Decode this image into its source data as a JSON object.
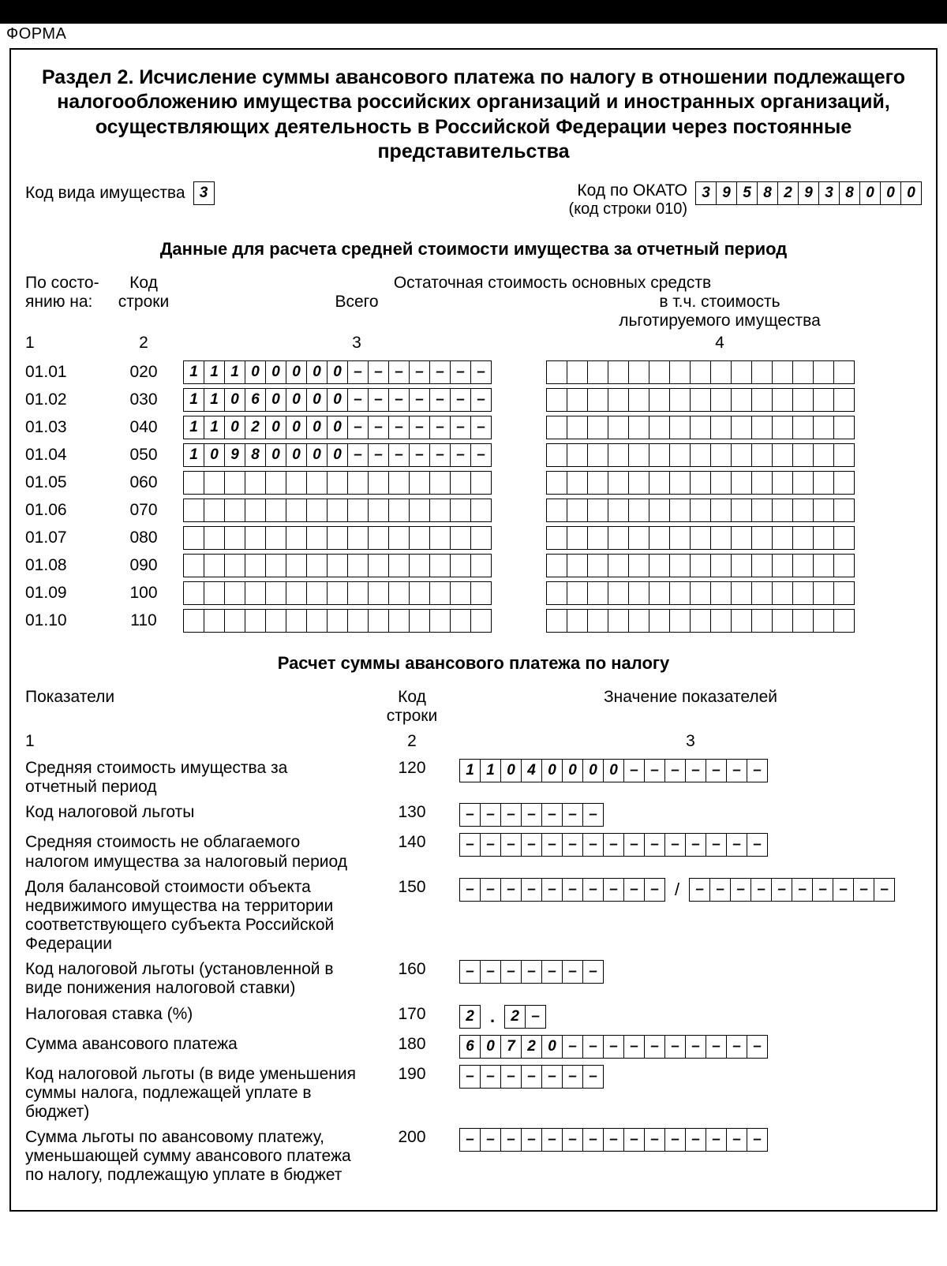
{
  "top_label": "ФОРМА",
  "title": "Раздел 2. Исчисление суммы авансового платежа по налогу в отношении подлежащего налогообложению имущества российских организаций и иностранных организаций, осуществляющих деятельность в Российской Федерации через постоянные представительства",
  "prop_code_label": "Код вида имущества",
  "prop_code": [
    "3"
  ],
  "okato_label": "Код по ОКАТО",
  "okato_sub": "(код строки 010)",
  "okato": [
    "3",
    "9",
    "5",
    "8",
    "2",
    "9",
    "3",
    "8",
    "0",
    "0",
    "0"
  ],
  "section1_head": "Данные для расчета средней стоимости имущества за отчетный период",
  "col_labels": {
    "state_on": "По состо-\nянию на:",
    "code": "Код\nстроки",
    "residual_head": "Остаточная стоимость основных средств",
    "total": "Всего",
    "privileged": "в т.ч. стоимость\nльготируемого имущества",
    "n1": "1",
    "n2": "2",
    "n3": "3",
    "n4": "4"
  },
  "rows": [
    {
      "date": "01.01",
      "code": "020",
      "v3": [
        "1",
        "1",
        "1",
        "0",
        "0",
        "0",
        "0",
        "0",
        "–",
        "–",
        "–",
        "–",
        "–",
        "–",
        "–"
      ],
      "v4": [
        "",
        "",
        "",
        "",
        "",
        "",
        "",
        "",
        "",
        "",
        "",
        "",
        "",
        "",
        ""
      ]
    },
    {
      "date": "01.02",
      "code": "030",
      "v3": [
        "1",
        "1",
        "0",
        "6",
        "0",
        "0",
        "0",
        "0",
        "–",
        "–",
        "–",
        "–",
        "–",
        "–",
        "–"
      ],
      "v4": [
        "",
        "",
        "",
        "",
        "",
        "",
        "",
        "",
        "",
        "",
        "",
        "",
        "",
        "",
        ""
      ]
    },
    {
      "date": "01.03",
      "code": "040",
      "v3": [
        "1",
        "1",
        "0",
        "2",
        "0",
        "0",
        "0",
        "0",
        "–",
        "–",
        "–",
        "–",
        "–",
        "–",
        "–"
      ],
      "v4": [
        "",
        "",
        "",
        "",
        "",
        "",
        "",
        "",
        "",
        "",
        "",
        "",
        "",
        "",
        ""
      ]
    },
    {
      "date": "01.04",
      "code": "050",
      "v3": [
        "1",
        "0",
        "9",
        "8",
        "0",
        "0",
        "0",
        "0",
        "–",
        "–",
        "–",
        "–",
        "–",
        "–",
        "–"
      ],
      "v4": [
        "",
        "",
        "",
        "",
        "",
        "",
        "",
        "",
        "",
        "",
        "",
        "",
        "",
        "",
        ""
      ]
    },
    {
      "date": "01.05",
      "code": "060",
      "v3": [
        "",
        "",
        "",
        "",
        "",
        "",
        "",
        "",
        "",
        "",
        "",
        "",
        "",
        "",
        ""
      ],
      "v4": [
        "",
        "",
        "",
        "",
        "",
        "",
        "",
        "",
        "",
        "",
        "",
        "",
        "",
        "",
        ""
      ]
    },
    {
      "date": "01.06",
      "code": "070",
      "v3": [
        "",
        "",
        "",
        "",
        "",
        "",
        "",
        "",
        "",
        "",
        "",
        "",
        "",
        "",
        ""
      ],
      "v4": [
        "",
        "",
        "",
        "",
        "",
        "",
        "",
        "",
        "",
        "",
        "",
        "",
        "",
        "",
        ""
      ]
    },
    {
      "date": "01.07",
      "code": "080",
      "v3": [
        "",
        "",
        "",
        "",
        "",
        "",
        "",
        "",
        "",
        "",
        "",
        "",
        "",
        "",
        ""
      ],
      "v4": [
        "",
        "",
        "",
        "",
        "",
        "",
        "",
        "",
        "",
        "",
        "",
        "",
        "",
        "",
        ""
      ]
    },
    {
      "date": "01.08",
      "code": "090",
      "v3": [
        "",
        "",
        "",
        "",
        "",
        "",
        "",
        "",
        "",
        "",
        "",
        "",
        "",
        "",
        ""
      ],
      "v4": [
        "",
        "",
        "",
        "",
        "",
        "",
        "",
        "",
        "",
        "",
        "",
        "",
        "",
        "",
        ""
      ]
    },
    {
      "date": "01.09",
      "code": "100",
      "v3": [
        "",
        "",
        "",
        "",
        "",
        "",
        "",
        "",
        "",
        "",
        "",
        "",
        "",
        "",
        ""
      ],
      "v4": [
        "",
        "",
        "",
        "",
        "",
        "",
        "",
        "",
        "",
        "",
        "",
        "",
        "",
        "",
        ""
      ]
    },
    {
      "date": "01.10",
      "code": "110",
      "v3": [
        "",
        "",
        "",
        "",
        "",
        "",
        "",
        "",
        "",
        "",
        "",
        "",
        "",
        "",
        ""
      ],
      "v4": [
        "",
        "",
        "",
        "",
        "",
        "",
        "",
        "",
        "",
        "",
        "",
        "",
        "",
        "",
        ""
      ]
    }
  ],
  "section2_head": "Расчет суммы авансового платежа по налогу",
  "calc_headers": {
    "indicators": "Показатели",
    "code": "Код\nстроки",
    "values": "Значение показателей",
    "n1": "1",
    "n2": "2",
    "n3": "3"
  },
  "calc_rows": [
    {
      "label": "Средняя стоимость имущества за отчетный период",
      "code": "120",
      "type": "cells",
      "cells": [
        "1",
        "1",
        "0",
        "4",
        "0",
        "0",
        "0",
        "0",
        "–",
        "–",
        "–",
        "–",
        "–",
        "–",
        "–"
      ]
    },
    {
      "label": "Код налоговой льготы",
      "code": "130",
      "type": "cells",
      "cells": [
        "–",
        "–",
        "–",
        "–",
        "–",
        "–",
        "–"
      ]
    },
    {
      "label": "Средняя стоимость не облагаемого налогом имущества за налоговый период",
      "code": "140",
      "type": "cells",
      "cells": [
        "–",
        "–",
        "–",
        "–",
        "–",
        "–",
        "–",
        "–",
        "–",
        "–",
        "–",
        "–",
        "–",
        "–",
        "–"
      ]
    },
    {
      "label": "Доля балансовой стоимости объекта недви­жимого имущества на территории соответст­вующего субъекта Российской Федерации",
      "code": "150",
      "type": "fraction",
      "left": [
        "–",
        "–",
        "–",
        "–",
        "–",
        "–",
        "–",
        "–",
        "–",
        "–"
      ],
      "right": [
        "–",
        "–",
        "–",
        "–",
        "–",
        "–",
        "–",
        "–",
        "–",
        "–"
      ]
    },
    {
      "label": "Код налоговой льготы (установленной в виде понижения налоговой ставки)",
      "code": "160",
      "type": "cells",
      "cells": [
        "–",
        "–",
        "–",
        "–",
        "–",
        "–",
        "–"
      ]
    },
    {
      "label": "Налоговая ставка (%)",
      "code": "170",
      "type": "rate",
      "int": [
        "2"
      ],
      "frac": [
        "2",
        "–"
      ]
    },
    {
      "label": "Сумма авансового платежа",
      "code": "180",
      "type": "cells",
      "cells": [
        "6",
        "0",
        "7",
        "2",
        "0",
        "–",
        "–",
        "–",
        "–",
        "–",
        "–",
        "–",
        "–",
        "–",
        "–"
      ]
    },
    {
      "label": "Код налоговой льготы (в виде уменьшения суммы налога, подлежащей уплате в бюджет)",
      "code": "190",
      "type": "cells",
      "cells": [
        "–",
        "–",
        "–",
        "–",
        "–",
        "–",
        "–"
      ]
    },
    {
      "label": "Сумма льготы по авансовому платежу, умень­шающей сумму авансового платежа по нало­гу, подлежащую уплате в бюджет",
      "code": "200",
      "type": "cells",
      "cells": [
        "–",
        "–",
        "–",
        "–",
        "–",
        "–",
        "–",
        "–",
        "–",
        "–",
        "–",
        "–",
        "–",
        "–",
        "–"
      ]
    }
  ]
}
